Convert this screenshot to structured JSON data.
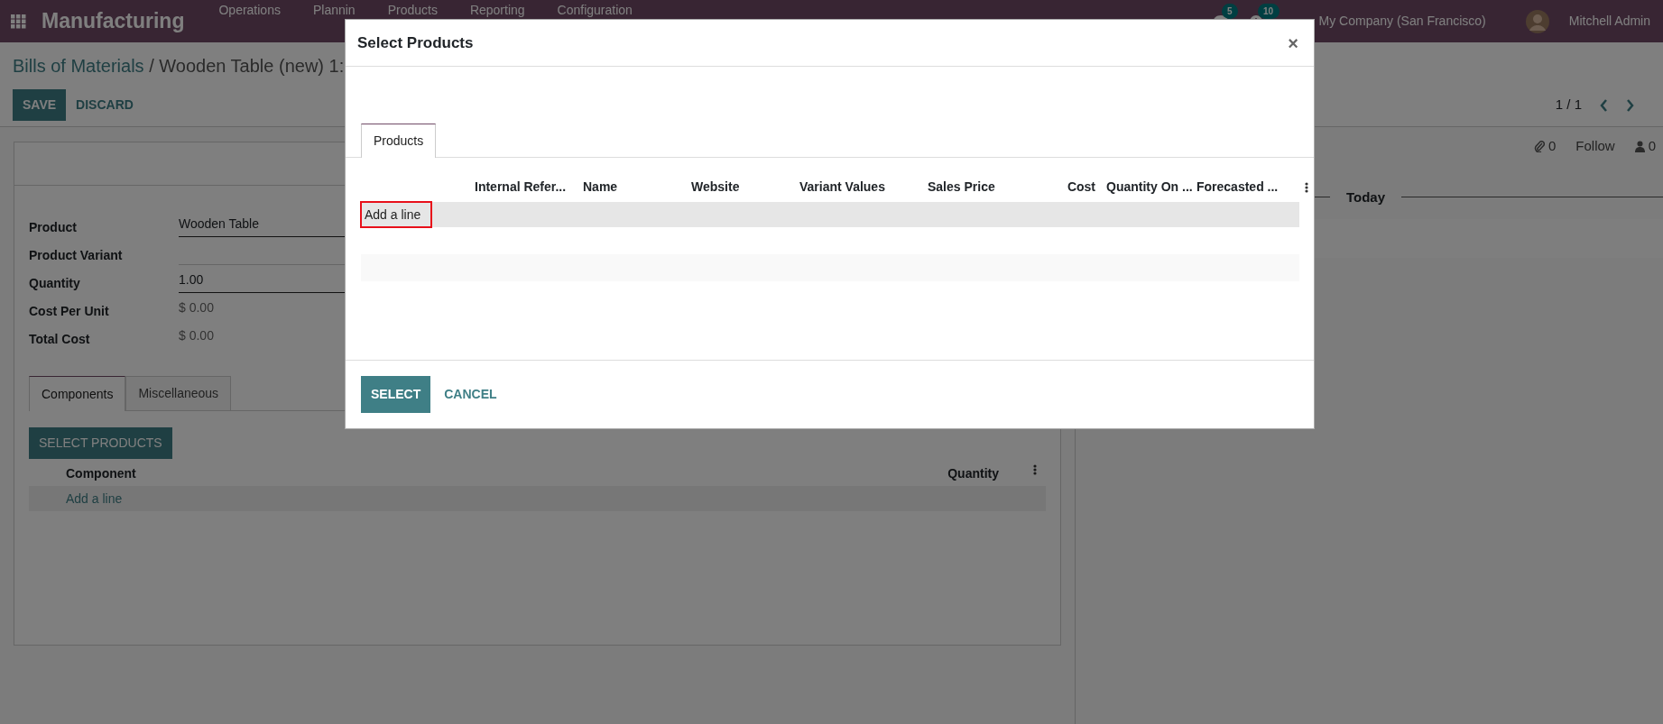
{
  "navbar": {
    "app_name": "Manufacturing",
    "menu": [
      "Operations",
      "Plannin",
      "Products",
      "Reporting",
      "Configuration"
    ],
    "chat_badge": "5",
    "activity_badge": "10",
    "company": "My Company (San Francisco)",
    "user": "Mitchell Admin"
  },
  "breadcrumb": {
    "parent": "Bills of Materials",
    "current": "/ Wooden Table (new) 1:"
  },
  "actions": [
    "SAVE",
    "DISCARD"
  ],
  "pager": "1 / 1",
  "form": {
    "fields": [
      {
        "label": "Product",
        "value": "Wooden Table",
        "kind": "input",
        "required": true
      },
      {
        "label": "Product Variant",
        "kind": "input",
        "required": false
      },
      {
        "label": "Quantity",
        "value": "1.00",
        "kind": "input",
        "required": true
      },
      {
        "label": "Cost Per Unit",
        "value": "$ 0.00",
        "kind": "text"
      },
      {
        "label": "Total Cost",
        "value": "$ 0.00",
        "kind": "text"
      }
    ],
    "tabs": [
      {
        "label": "Components",
        "selected": true
      },
      {
        "label": "Miscellaneous",
        "selected": false
      }
    ],
    "select_button": "SELECT PRODUCTS",
    "lines": {
      "columns": [
        "Component",
        "Quantity"
      ],
      "add_line": "Add a line"
    }
  },
  "chatter": {
    "attachments": "0",
    "follow": "Follow",
    "followers": "0",
    "separator": "Today"
  },
  "modal": {
    "title": "Select Products",
    "close": "×",
    "tabs": [
      {
        "label": "Products",
        "selected": true
      }
    ],
    "columns": [
      "Internal Refer...",
      "Name",
      "Website",
      "Variant Values",
      "Sales Price",
      "Cost",
      "Quantity On ...",
      "Forecasted ..."
    ],
    "add_line": {
      "label": "Add a line",
      "highlighted": true
    },
    "buttons": [
      {
        "label": "SELECT",
        "kind": "primary"
      },
      {
        "label": "CANCEL",
        "kind": "link"
      }
    ]
  }
}
